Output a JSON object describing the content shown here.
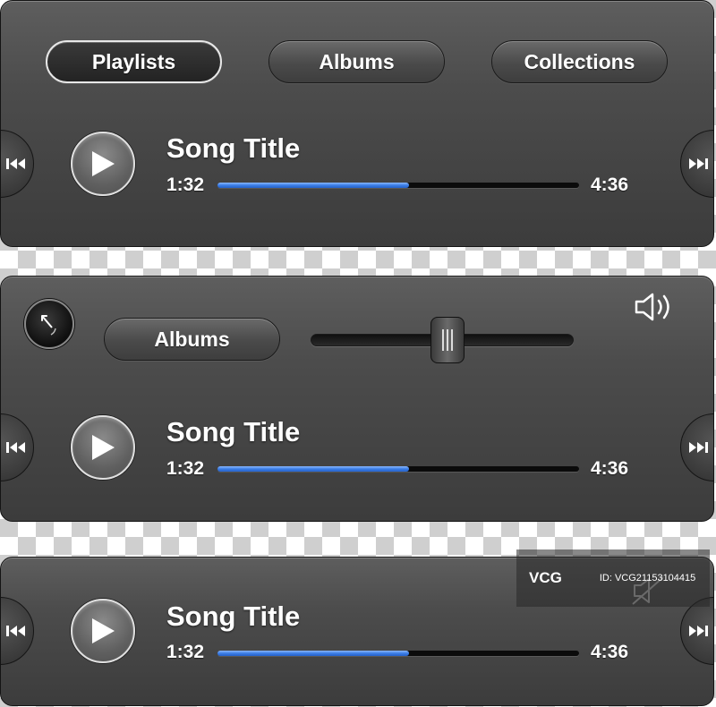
{
  "panel1": {
    "tabs": [
      {
        "label": "Playlists",
        "active": true
      },
      {
        "label": "Albums",
        "active": false
      },
      {
        "label": "Collections",
        "active": false
      }
    ],
    "song_title": "Song Title",
    "elapsed": "1:32",
    "duration": "4:36",
    "progress": 0.53
  },
  "panel2": {
    "albums_label": "Albums",
    "volume_level": 0.52,
    "song_title": "Song Title",
    "elapsed": "1:32",
    "duration": "4:36",
    "progress": 0.53
  },
  "panel3": {
    "song_title": "Song Title",
    "elapsed": "1:32",
    "duration": "4:36",
    "progress": 0.53
  },
  "watermark": {
    "logo": "VCG",
    "id_text": "ID: VCG21153104415"
  },
  "icons": {
    "prev": "rewind-icon",
    "next": "fast-forward-icon",
    "play": "play-icon",
    "volume": "speaker-icon",
    "back": "clock-back-icon"
  },
  "colors": {
    "progress_fill": "#3c7ee6",
    "panel_bg": "#4c4c4c",
    "text": "#ffffff"
  }
}
